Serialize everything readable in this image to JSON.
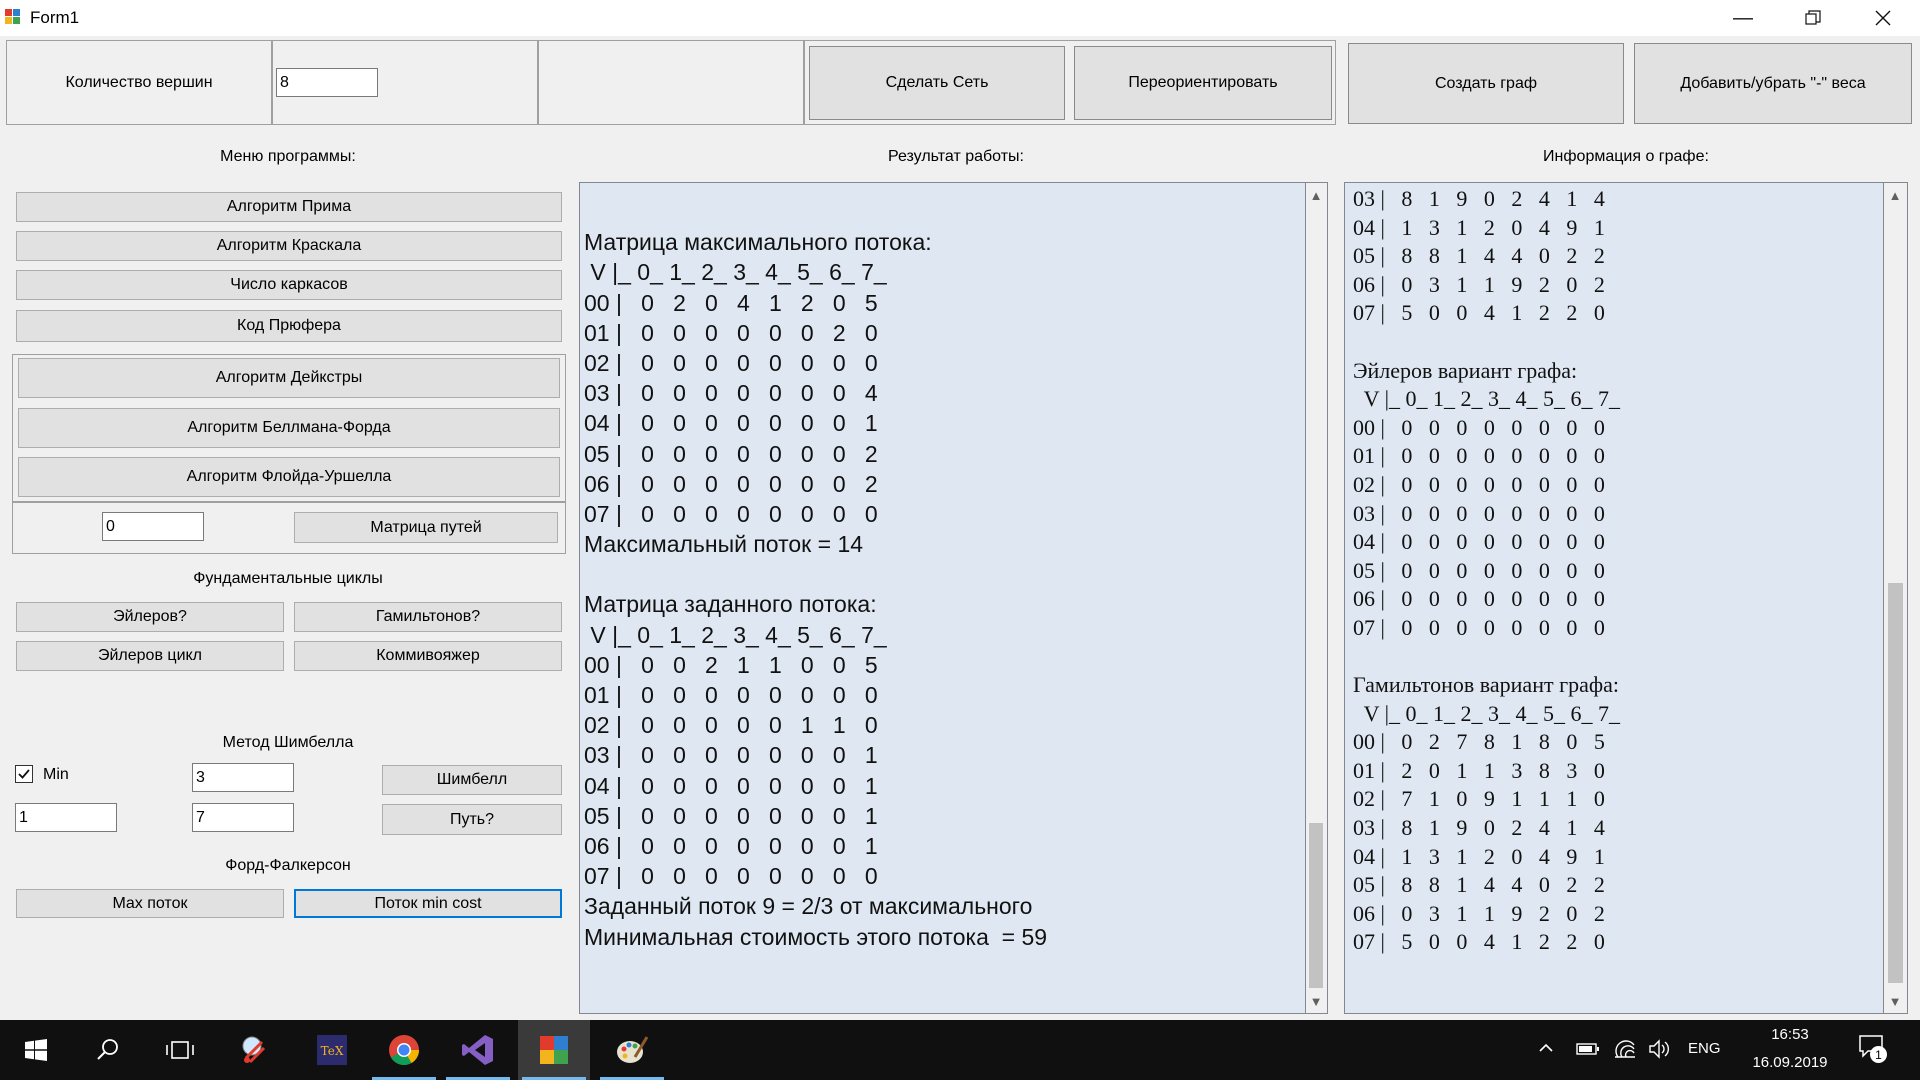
{
  "window": {
    "title": "Form1"
  },
  "toolbar": {
    "vertex_count_label": "Количество вершин",
    "vertex_count_value": "8",
    "make_network": "Сделать Сеть",
    "reorient": "Переориентировать",
    "create_graph": "Создать граф",
    "toggle_weights": "Добавить/убрать \"-\" веса"
  },
  "menu": {
    "title": "Меню программы:",
    "prim": "Алгоритм Прима",
    "kruskal": "Алгоритм Краскала",
    "spanning_trees": "Число каркасов",
    "prufer": "Код Прюфера",
    "dijkstra": "Алгоритм Дейкстры",
    "bellman_ford": "Алгоритм Беллмана-Форда",
    "floyd_warshall": "Алгоритм Флойда-Уршелла",
    "path_input": "0",
    "path_matrix": "Матрица путей",
    "fundamental_title": "Фундаментальные циклы",
    "euler_q": "Эйлеров?",
    "hamilton_q": "Гамильтонов?",
    "euler_cycle": "Эйлеров цикл",
    "salesman": "Коммивояжер",
    "shimbell_title": "Метод Шимбелла",
    "min_label": "Min",
    "min_checked": true,
    "shimbell_input1": "3",
    "shimbell_button": "Шимбелл",
    "shimbell_input2": "1",
    "shimbell_input3": "7",
    "path_q": "Путь?",
    "ford_title": "Форд-Фалкерсон",
    "max_flow": "Max поток",
    "min_cost_flow": "Поток min cost"
  },
  "result": {
    "title": "Результат работы:",
    "lines": [
      "",
      "Матрица максимального потока:",
      " V |_ 0_ 1_ 2_ 3_ 4_ 5_ 6_ 7_",
      "00 |   0   2   0   4   1   2   0   5",
      "01 |   0   0   0   0   0   0   2   0",
      "02 |   0   0   0   0   0   0   0   0",
      "03 |   0   0   0   0   0   0   0   4",
      "04 |   0   0   0   0   0   0   0   1",
      "05 |   0   0   0   0   0   0   0   2",
      "06 |   0   0   0   0   0   0   0   2",
      "07 |   0   0   0   0   0   0   0   0",
      "Максимальный поток = 14",
      "",
      "Матрица заданного потока:",
      " V |_ 0_ 1_ 2_ 3_ 4_ 5_ 6_ 7_",
      "00 |   0   0   2   1   1   0   0   5",
      "01 |   0   0   0   0   0   0   0   0",
      "02 |   0   0   0   0   0   1   1   0",
      "03 |   0   0   0   0   0   0   0   1",
      "04 |   0   0   0   0   0   0   0   1",
      "05 |   0   0   0   0   0   0   0   1",
      "06 |   0   0   0   0   0   0   0   1",
      "07 |   0   0   0   0   0   0   0   0",
      "Заданный поток 9 = 2/3 от максимального",
      "Минимальная стоимость этого потока  = 59"
    ]
  },
  "info": {
    "title": "Информация о графе:",
    "lines": [
      "03 |   8   1   9   0   2   4   1   4",
      "04 |   1   3   1   2   0   4   9   1",
      "05 |   8   8   1   4   4   0   2   2",
      "06 |   0   3   1   1   9   2   0   2",
      "07 |   5   0   0   4   1   2   2   0",
      "",
      "Эйлеров вариант графа:",
      "  V |_ 0_ 1_ 2_ 3_ 4_ 5_ 6_ 7_",
      "00 |   0   0   0   0   0   0   0   0",
      "01 |   0   0   0   0   0   0   0   0",
      "02 |   0   0   0   0   0   0   0   0",
      "03 |   0   0   0   0   0   0   0   0",
      "04 |   0   0   0   0   0   0   0   0",
      "05 |   0   0   0   0   0   0   0   0",
      "06 |   0   0   0   0   0   0   0   0",
      "07 |   0   0   0   0   0   0   0   0",
      "",
      "Гамильтонов вариант графа:",
      "  V |_ 0_ 1_ 2_ 3_ 4_ 5_ 6_ 7_",
      "00 |   0   2   7   8   1   8   0   5",
      "01 |   2   0   1   1   3   8   3   0",
      "02 |   7   1   0   9   1   1   1   0",
      "03 |   8   1   9   0   2   4   1   4",
      "04 |   1   3   1   2   0   4   9   1",
      "05 |   8   8   1   4   4   0   2   2",
      "06 |   0   3   1   1   9   2   0   2",
      "07 |   5   0   0   4   1   2   2   0"
    ]
  },
  "taskbar": {
    "language": "ENG",
    "time": "16:53",
    "date": "16.09.2019",
    "notifications": "1"
  }
}
